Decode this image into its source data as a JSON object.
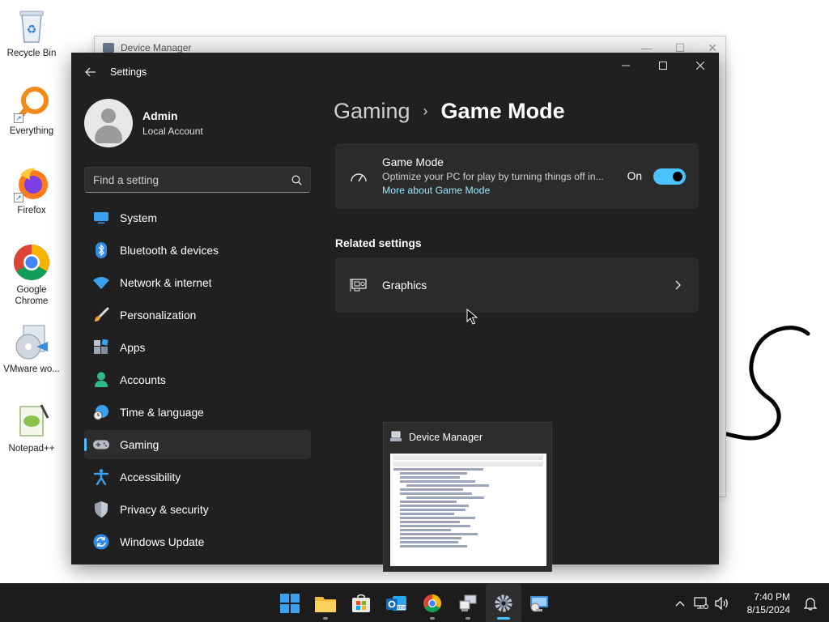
{
  "desktop": {
    "icons": [
      {
        "label": "Recycle Bin"
      },
      {
        "label": "Everything"
      },
      {
        "label": "Firefox"
      },
      {
        "label": "Google Chrome"
      },
      {
        "label": "VMware wo..."
      },
      {
        "label": "Notepad++"
      }
    ]
  },
  "background_window": {
    "title": "Device Manager"
  },
  "settings": {
    "title": "Settings",
    "user": {
      "name": "Admin",
      "account_type": "Local Account"
    },
    "search": {
      "placeholder": "Find a setting"
    },
    "nav": [
      {
        "label": "System",
        "icon": "monitor-icon"
      },
      {
        "label": "Bluetooth & devices",
        "icon": "bluetooth-icon"
      },
      {
        "label": "Network & internet",
        "icon": "wifi-icon"
      },
      {
        "label": "Personalization",
        "icon": "brush-icon"
      },
      {
        "label": "Apps",
        "icon": "apps-icon"
      },
      {
        "label": "Accounts",
        "icon": "person-icon"
      },
      {
        "label": "Time & language",
        "icon": "globe-clock-icon"
      },
      {
        "label": "Gaming",
        "icon": "gamepad-icon",
        "active": true
      },
      {
        "label": "Accessibility",
        "icon": "accessibility-icon"
      },
      {
        "label": "Privacy & security",
        "icon": "shield-icon"
      },
      {
        "label": "Windows Update",
        "icon": "update-icon"
      }
    ],
    "breadcrumb": {
      "parent": "Gaming",
      "current": "Game Mode"
    },
    "game_mode_card": {
      "title": "Game Mode",
      "description": "Optimize your PC for play by turning things off in...",
      "link": "More about Game Mode",
      "toggle_label": "On",
      "toggle_on": true
    },
    "related_settings": {
      "heading": "Related settings",
      "graphics_label": "Graphics"
    }
  },
  "taskbar_preview": {
    "title": "Device Manager"
  },
  "taskbar": {
    "apps": [
      "start-icon",
      "file-explorer-icon",
      "store-icon",
      "outlook-icon",
      "chrome-icon",
      "device-manager-icon",
      "settings-icon",
      "remote-desktop-icon"
    ],
    "active_app": "settings-icon",
    "clock": {
      "time": "7:40 PM",
      "date": "8/15/2024"
    }
  },
  "colors": {
    "accent": "#4cc2ff",
    "link": "#99ebff",
    "window_bg": "#202020",
    "card_bg": "#2b2b2b"
  }
}
